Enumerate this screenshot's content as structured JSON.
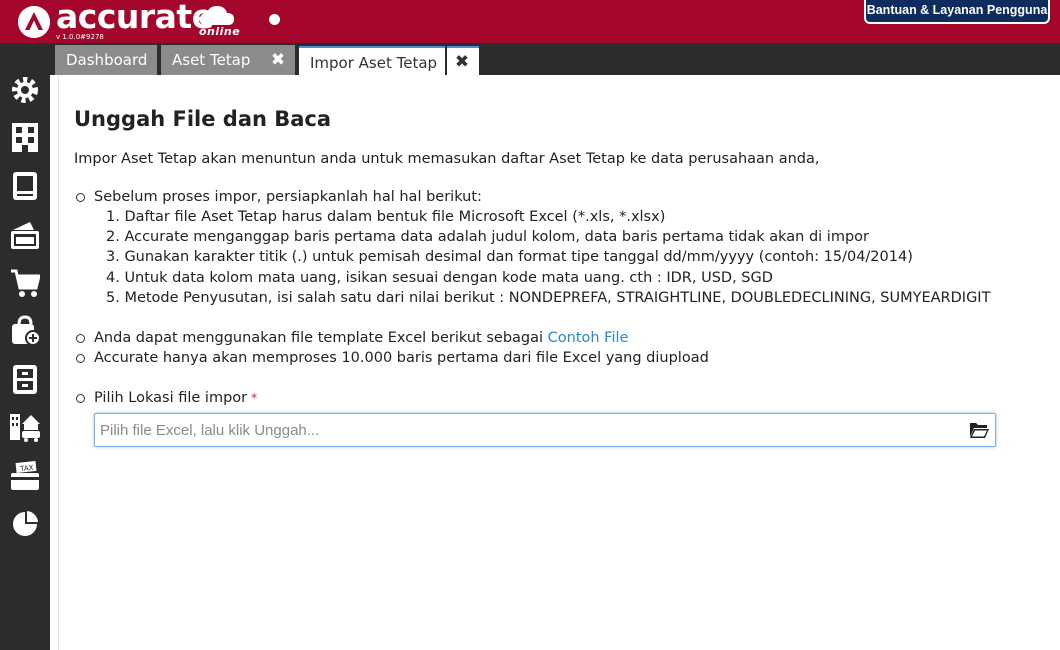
{
  "header": {
    "logo_text": "accurate",
    "logo_sub": "online",
    "version": "v 1.0.0#9278",
    "help_label": "Bantuan & Layanan Pengguna"
  },
  "tabs": [
    {
      "label": "Dashboard",
      "closable": false
    },
    {
      "label": "Aset Tetap",
      "closable": true,
      "close_symbol": "✖"
    },
    {
      "label": "Impor Aset Tetap",
      "closable": true,
      "active": true,
      "close_symbol": "✖"
    }
  ],
  "sidebar": {
    "icons": [
      "gear-icon",
      "building-icon",
      "book-icon",
      "wallet-icon",
      "cart-icon",
      "shopping-bag-add-icon",
      "cabinet-icon",
      "property-vehicle-icon",
      "tax-icon",
      "pie-chart-icon"
    ]
  },
  "main": {
    "title": "Unggah File dan Baca",
    "intro": "Impor Aset Tetap akan menuntun anda untuk memasukan daftar Aset Tetap ke data perusahaan anda,",
    "prepare_heading": "Sebelum proses impor, persiapkanlah hal hal berikut:",
    "steps": [
      "1. Daftar file Aset Tetap harus dalam bentuk file Microsoft Excel (*.xls, *.xlsx)",
      "2. Accurate menganggap baris pertama data adalah judul kolom, data baris pertama tidak akan di impor",
      "3. Gunakan karakter titik (.) untuk pemisah desimal dan format tipe tanggal dd/mm/yyyy (contoh: 15/04/2014)",
      "4. Untuk data kolom mata uang, isikan sesuai dengan kode mata uang. cth : IDR, USD, SGD",
      "5. Metode Penyusutan, isi salah satu dari nilai berikut : NONDEPREFA, STRAIGHTLINE, DOUBLEDECLINING, SUMYEARDIGIT"
    ],
    "template_text": "Anda dapat menggunakan file template Excel berikut sebagai",
    "template_link": "Contoh File",
    "limit_text": "Accurate hanya akan memproses 10.000 baris pertama dari file Excel yang diupload",
    "file_label": "Pilih Lokasi file impor",
    "required_mark": "*",
    "file_placeholder": "Pilih file Excel, lalu klik Unggah...",
    "file_value": ""
  },
  "colors": {
    "brand": "#a5062c",
    "help_bg": "#0e2d5e",
    "link": "#2a8ac9",
    "sidebar_bg": "#2c2c2c"
  }
}
